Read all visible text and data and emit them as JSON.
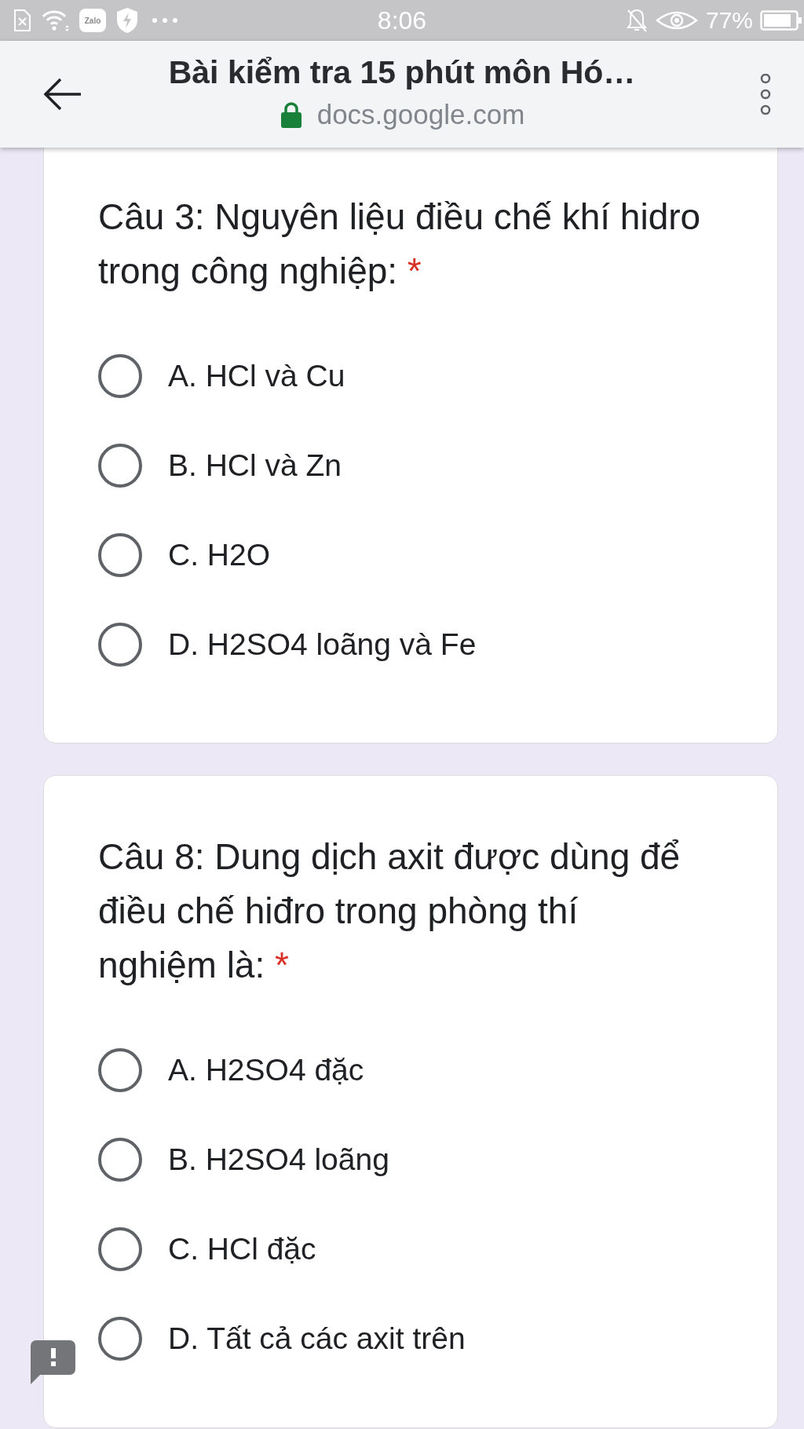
{
  "status_bar": {
    "app_badge": "Zalo",
    "time": "8:06",
    "battery": "77%"
  },
  "header": {
    "title": "Bài kiểm tra 15 phút môn Hó…",
    "url": "docs.google.com"
  },
  "questions": [
    {
      "text": "Câu 3: Nguyên liệu điều chế khí hidro trong công nghiệp:",
      "required_mark": "*",
      "options": [
        {
          "label": "A. HCl và Cu",
          "selected": false
        },
        {
          "label": "B. HCl và Zn",
          "selected": false
        },
        {
          "label": "C. H2O",
          "selected": false
        },
        {
          "label": "D. H2SO4 loãng và Fe",
          "selected": false
        }
      ]
    },
    {
      "text": "Câu 8: Dung dịch axit được dùng để điều chế hiđro trong phòng thí nghiệm là:",
      "required_mark": "*",
      "options": [
        {
          "label": "A. H2SO4 đặc",
          "selected": false
        },
        {
          "label": "B. H2SO4 loãng",
          "selected": false
        },
        {
          "label": "C. HCl đặc",
          "selected": false
        },
        {
          "label": "D. Tất cả các axit trên",
          "selected": false
        }
      ]
    }
  ]
}
